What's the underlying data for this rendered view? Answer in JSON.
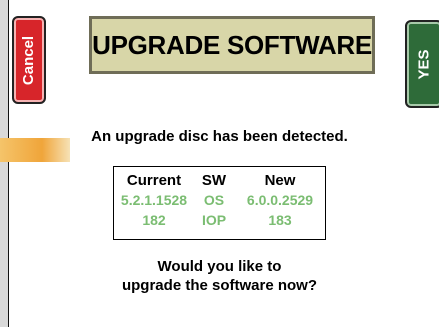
{
  "dialog": {
    "title": "UPGRADE SOFTWARE",
    "cancel_label": "Cancel",
    "yes_label": "YES",
    "message": "An upgrade disc has been detected.",
    "question_line1": "Would you like to",
    "question_line2": "upgrade the software now?"
  },
  "versions": {
    "headers": [
      "Current",
      "SW",
      "New"
    ],
    "rows": [
      {
        "current": "5.2.1.1528",
        "sw": "OS",
        "new": "6.0.0.2529"
      },
      {
        "current": "182",
        "sw": "IOP",
        "new": "183"
      }
    ]
  },
  "colors": {
    "cancel": "#d7252a",
    "yes": "#2e6b39",
    "title_bg": "#d8d6a8",
    "value_text": "#7bbd72"
  }
}
